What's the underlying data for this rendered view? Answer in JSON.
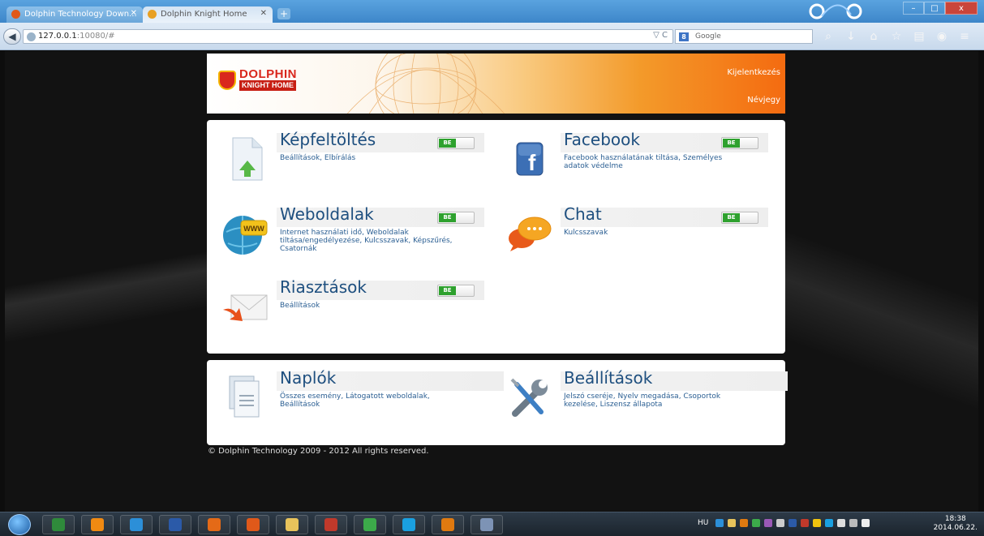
{
  "browser": {
    "tabs": [
      {
        "label": "Dolphin Technology Down...",
        "active": false
      },
      {
        "label": "Dolphin Knight Home",
        "active": true
      }
    ],
    "url_host": "127.0.0.1",
    "url_rest": ":10080/#",
    "search_placeholder": "Google",
    "window_buttons": [
      "–",
      "□",
      "x"
    ]
  },
  "header": {
    "logo_line1": "DOLPHIN",
    "logo_line2": "KNIGHT HOME",
    "logout": "Kijelentkezés",
    "business_card": "Névjegy"
  },
  "modules": [
    {
      "id": "kepfeltoltes",
      "title": "Képfeltöltés",
      "desc": "Beállítások, Elbírálás",
      "toggle": "BE",
      "icon": "upload-document-icon"
    },
    {
      "id": "facebook",
      "title": "Facebook",
      "desc": "Facebook használatának tiltása, Személyes adatok védelme",
      "toggle": "BE",
      "icon": "facebook-icon"
    },
    {
      "id": "weboldalak",
      "title": "Weboldalak",
      "desc": "Internet használati idő, Weboldalak tiltása/engedélyezése, Kulcsszavak, Képszűrés, Csatornák",
      "toggle": "BE",
      "icon": "www-globe-icon"
    },
    {
      "id": "chat",
      "title": "Chat",
      "desc": "Kulcsszavak",
      "toggle": "BE",
      "icon": "chat-bubbles-icon"
    },
    {
      "id": "riasztasok",
      "title": "Riasztások",
      "desc": "Beállítások",
      "toggle": "BE",
      "icon": "envelope-alert-icon"
    },
    {
      "id": "naplok",
      "title": "Naplók",
      "desc": "Összes esemény, Látogatott weboldalak, Beállítások",
      "icon": "documents-icon"
    },
    {
      "id": "beallitasok",
      "title": "Beállítások",
      "desc": "Jelszó cseréje, Nyelv megadása, Csoportok kezelése, Liszensz állapota",
      "icon": "wrench-screwdriver-icon"
    }
  ],
  "footer": "© Dolphin Technology 2009 - 2012 All rights reserved.",
  "taskbar": {
    "apps": [
      {
        "name": "excel-icon",
        "color": "#2f8a3b"
      },
      {
        "name": "vlc-icon",
        "color": "#f08a12"
      },
      {
        "name": "internet-explorer-icon",
        "color": "#2c8fd8"
      },
      {
        "name": "word-icon",
        "color": "#2b5aa8"
      },
      {
        "name": "player-icon",
        "color": "#e46a17"
      },
      {
        "name": "firefox-icon",
        "color": "#e0591a"
      },
      {
        "name": "folder-icon",
        "color": "#e8c35b"
      },
      {
        "name": "app-icon",
        "color": "#c0392b"
      },
      {
        "name": "chrome-icon",
        "color": "#3caa4a"
      },
      {
        "name": "skype-icon",
        "color": "#1aa0e0"
      },
      {
        "name": "outlook-icon",
        "color": "#e07a10"
      },
      {
        "name": "paint-icon",
        "color": "#7d93b5"
      }
    ],
    "language": "HU",
    "time": "18:38",
    "date": "2014.06.22."
  }
}
